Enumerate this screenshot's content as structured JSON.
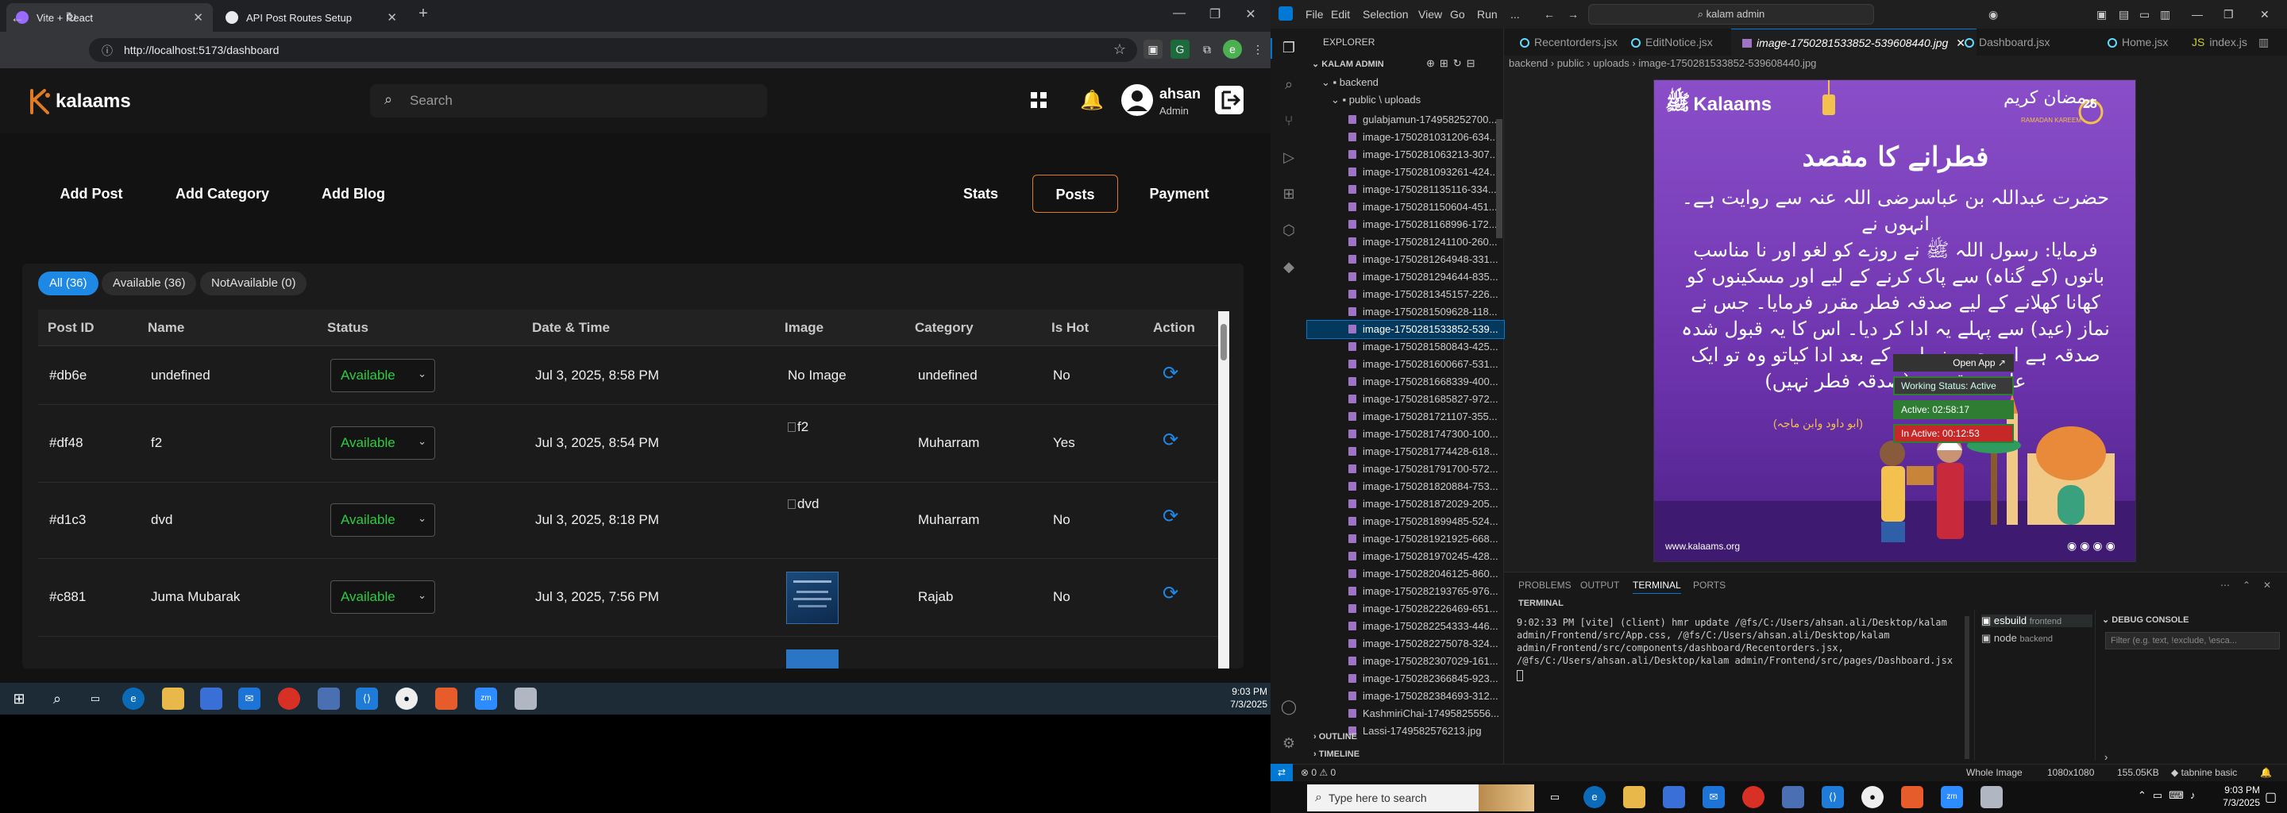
{
  "browser": {
    "tabs": [
      {
        "title": "Vite + React",
        "active": true
      },
      {
        "title": "API Post Routes Setup",
        "active": false
      }
    ],
    "url": "http://localhost:5173/dashboard",
    "profile_initial": "e"
  },
  "app": {
    "logo": "kalaams",
    "search_placeholder": "Search",
    "user_name": "ahsan",
    "user_role": "Admin",
    "left_nav": [
      "Add Post",
      "Add Category",
      "Add Blog"
    ],
    "right_nav": [
      "Stats",
      "Posts",
      "Payment"
    ],
    "active_nav": "Posts",
    "filters": [
      "All (36)",
      "Available (36)",
      "NotAvailable (0)"
    ],
    "table": {
      "headers": [
        "Post ID",
        "Name",
        "Status",
        "Date & Time",
        "Image",
        "Category",
        "Is Hot",
        "Action"
      ],
      "rows": [
        {
          "id": "#db6e",
          "name": "undefined",
          "status": "Available",
          "date": "Jul 3, 2025, 8:58 PM",
          "image": "No Image",
          "category": "undefined",
          "hot": "No"
        },
        {
          "id": "#df48",
          "name": "f2",
          "status": "Available",
          "date": "Jul 3, 2025, 8:54 PM",
          "image": "f2",
          "category": "Muharram",
          "hot": "Yes"
        },
        {
          "id": "#d1c3",
          "name": "dvd",
          "status": "Available",
          "date": "Jul 3, 2025, 8:18 PM",
          "image": "dvd",
          "category": "Muharram",
          "hot": "No"
        },
        {
          "id": "#c881",
          "name": "Juma Mubarak",
          "status": "Available",
          "date": "Jul 3, 2025, 7:56 PM",
          "image": "thumbnail",
          "category": "Rajab",
          "hot": "No"
        }
      ]
    }
  },
  "taskbar_left": {
    "time": "9:03 PM",
    "date": "7/3/2025"
  },
  "vscode": {
    "menu": [
      "File",
      "Edit",
      "Selection",
      "View",
      "Go",
      "Run",
      "..."
    ],
    "search": "kalam admin",
    "explorer_title": "EXPLORER",
    "workspace": "KALAM ADMIN",
    "folders": [
      "backend",
      "public \\ uploads"
    ],
    "files": [
      "gulabjamun-174958252700...",
      "image-1750281031206-634...",
      "image-1750281063213-307...",
      "image-1750281093261-424...",
      "image-1750281135116-334...",
      "image-1750281150604-451...",
      "image-1750281168996-172...",
      "image-1750281241100-260...",
      "image-1750281264948-331...",
      "image-1750281294644-835...",
      "image-1750281345157-226...",
      "image-1750281509628-118...",
      "image-1750281533852-539...",
      "image-1750281580843-425...",
      "image-1750281600667-531...",
      "image-1750281668339-400...",
      "image-1750281685827-972...",
      "image-1750281721107-355...",
      "image-1750281747300-100...",
      "image-1750281774428-618...",
      "image-1750281791700-572...",
      "image-1750281820884-753...",
      "image-1750281872029-205...",
      "image-1750281899485-524...",
      "image-1750281921925-668...",
      "image-1750281970245-428...",
      "image-1750282046125-860...",
      "image-1750282193765-976...",
      "image-1750282226469-651...",
      "image-1750282254333-446...",
      "image-1750282275078-324...",
      "image-1750282307029-161...",
      "image-1750282366845-923...",
      "image-1750282384693-312...",
      "KashmiriChai-17495825556...",
      "Lassi-1749582576213.jpg"
    ],
    "selected_file_index": 12,
    "outline": "OUTLINE",
    "timeline": "TIMELINE",
    "editor_tabs": [
      "Recentorders.jsx",
      "EditNotice.jsx",
      "image-1750281533852-539608440.jpg",
      "Dashboard.jsx",
      "Home.jsx",
      "index.js"
    ],
    "active_tab_index": 2,
    "breadcrumb": "backend › public › uploads › image-1750281533852-539608440.jpg",
    "image": {
      "brand": "Kalaams",
      "title": "فطرانے کا مقصد",
      "lines": [
        "حضرت عبداللہ بن عباسرضی اللہ عنہ سے روایت ہے۔ انہوں نے",
        "فرمایا: رسول اللہ ﷺ نے روزے کو لغو اور نا مناسب",
        "باتوں (کے گناہ) سے پاک کرنے کے لیے اور مسکینوں کو",
        "کھانا کھلانے کے لیے صدقہ فطر مقرر فرمایا۔ جس نے",
        "نماز (عید) سے پہلے یہ ادا کر دیا۔ اس کا یہ قبول شدہ",
        "صدقہ ہے اور جس نے اس کے بعد ادا کیاتو وہ تو ایک",
        "عام صدقہ ہے (صدقہ فطر نہیں)"
      ],
      "source": "(ابو داود وابن ماجہ)",
      "ramadan": "رمضان کریم",
      "ramadan_en": "RAMADAN KAREEM",
      "day": "25",
      "website": "www.kalaams.org"
    },
    "overlay": {
      "open_app": "Open App ↗",
      "working": "Working Status: Active",
      "active": "Active: 02:58:17",
      "inactive": "In Active: 00:12:53"
    },
    "panel_tabs": [
      "PROBLEMS",
      "OUTPUT",
      "TERMINAL",
      "PORTS"
    ],
    "active_panel_tab": "TERMINAL",
    "terminal_label": "TERMINAL",
    "terminal_text": "9:02:33 PM [vite] (client) hmr update /@fs/C:/Users/ahsan.ali/Desktop/kalam admin/Frontend/src/App.css, /@fs/C:/Users/ahsan.ali/Desktop/kalam admin/Frontend/src/components/dashboard/Recentorders.jsx, /@fs/C:/Users/ahsan.ali/Desktop/kalam admin/Frontend/src/pages/Dashboard.jsx",
    "terminals": [
      {
        "name": "esbuild",
        "sub": "frontend"
      },
      {
        "name": "node",
        "sub": "backend"
      }
    ],
    "debug_console": "DEBUG CONSOLE",
    "debug_filter_placeholder": "Filter (e.g. text, !exclude, \\esca...",
    "status": {
      "errors": "0",
      "warnings": "0",
      "whole_image": "Whole Image",
      "dims": "1080x1080",
      "size": "155.05KB",
      "tabnine": "tabnine basic"
    }
  },
  "taskbar_right": {
    "search_placeholder": "Type here to search",
    "time": "9:03 PM",
    "date": "7/3/2025"
  },
  "colors": {
    "accent_orange": "#e07b24",
    "status_green": "#2ecc40",
    "pill_blue": "#1e88e5",
    "vscode_blue": "#0078d4",
    "image_purple": "#7a3fb0"
  }
}
